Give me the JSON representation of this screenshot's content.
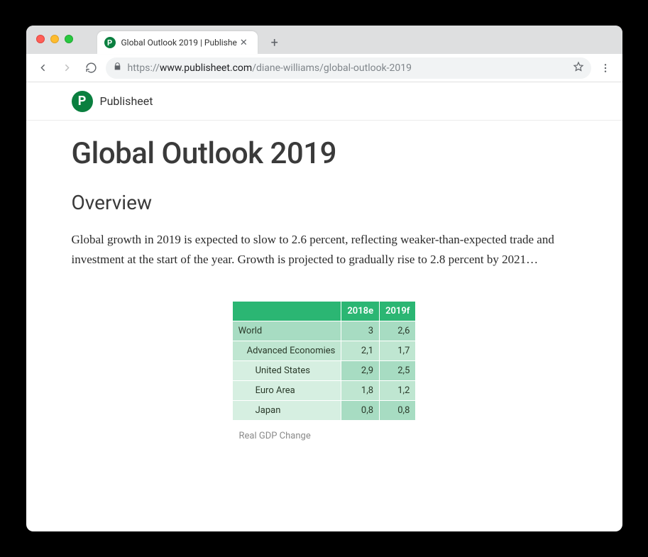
{
  "browser": {
    "tab_title": "Global Outlook 2019 | Publishe",
    "url_scheme": "https://",
    "url_host": "www.publisheet.com",
    "url_path": "/diane-williams/global-outlook-2019"
  },
  "brand": {
    "name": "Publisheet",
    "logo_letter": "P"
  },
  "page": {
    "title": "Global Outlook 2019",
    "section_heading": "Overview",
    "body": "Global growth in 2019 is expected to slow to 2.6 percent, reflecting weaker-than-expected trade and investment at the start of the year. Growth is projected to gradually rise to 2.8 percent by 2021…",
    "table_caption": "Real GDP Change"
  },
  "chart_data": {
    "type": "table",
    "title": "Real GDP Change",
    "columns": [
      "",
      "2018e",
      "2019f"
    ],
    "rows": [
      {
        "label": "World",
        "indent": 0,
        "values": [
          "3",
          "2,6"
        ]
      },
      {
        "label": "Advanced Economies",
        "indent": 1,
        "values": [
          "2,1",
          "1,7"
        ]
      },
      {
        "label": "United States",
        "indent": 2,
        "values": [
          "2,9",
          "2,5"
        ]
      },
      {
        "label": "Euro Area",
        "indent": 2,
        "values": [
          "1,8",
          "1,2"
        ]
      },
      {
        "label": "Japan",
        "indent": 2,
        "values": [
          "0,8",
          "0,8"
        ]
      }
    ]
  }
}
